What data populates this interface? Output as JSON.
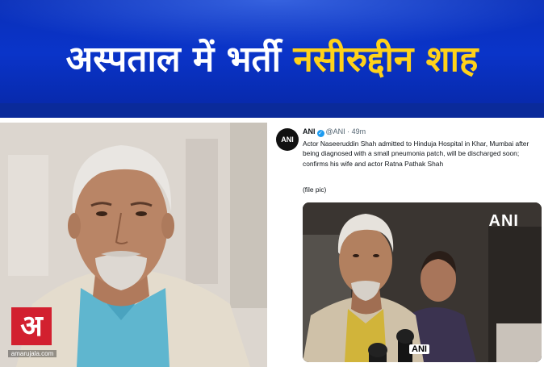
{
  "headline": {
    "part1": "अस्पताल में भर्ती",
    "part2": "नसीरुद्दीन शाह"
  },
  "photo": {
    "logo_glyph": "अ",
    "logo_url": "amarujala.com"
  },
  "tweet": {
    "avatar_text": "ANI",
    "name": "ANI",
    "handle": "@ANI",
    "separator": "·",
    "time": "49m",
    "text": "Actor Naseeruddin Shah admitted to Hinduja Hospital in Khar, Mumbai after being diagnosed with a small pneumonia patch, will be discharged soon; confirms his wife and actor Ratna Pathak Shah",
    "file_note": "(file pic)",
    "media_watermark": "ANI",
    "mic_label": "ANI"
  },
  "colors": {
    "banner_blue": "#0a34c9",
    "headline_white": "#ffffff",
    "headline_yellow": "#ffd21a",
    "logo_red": "#d2202f",
    "verified_blue": "#1d9bf0"
  }
}
